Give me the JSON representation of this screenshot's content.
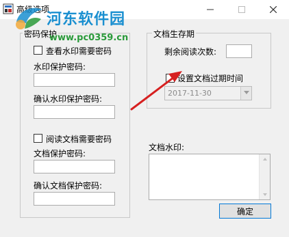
{
  "window": {
    "title": "高级选项",
    "minimize_icon": "minimize-icon",
    "maximize_icon": "maximize-icon",
    "close_icon": "close-icon"
  },
  "watermark": {
    "site_name": "河东软件园",
    "site_url": "www.pc0359.cn",
    "colors": {
      "title": "#1a8fd0",
      "url": "#2a9a3a"
    }
  },
  "password_group": {
    "legend": "密码保护",
    "view_watermark_checkbox": {
      "label": "查看水印需要密码",
      "checked": false
    },
    "watermark_password_label": "水印保护密码:",
    "watermark_password_value": "",
    "confirm_watermark_password_label": "确认水印保护密码:",
    "confirm_watermark_password_value": "",
    "read_document_checkbox": {
      "label": "阅读文档需要密码",
      "checked": false
    },
    "document_password_label": "文档保护密码:",
    "document_password_value": "",
    "confirm_document_password_label": "确认文档保护密码:",
    "confirm_document_password_value": ""
  },
  "lifetime_group": {
    "legend": "文档生存期",
    "remaining_reads_label": "剩余阅读次数:",
    "remaining_reads_value": "",
    "expire_checkbox": {
      "label": "设置文档过期时间",
      "checked": false
    },
    "expire_date": "2017-11-30"
  },
  "doc_watermark": {
    "label": "文档水印:",
    "value": ""
  },
  "ok_button": {
    "label": "确定"
  },
  "annotation": {
    "arrow_color": "#d62020"
  }
}
